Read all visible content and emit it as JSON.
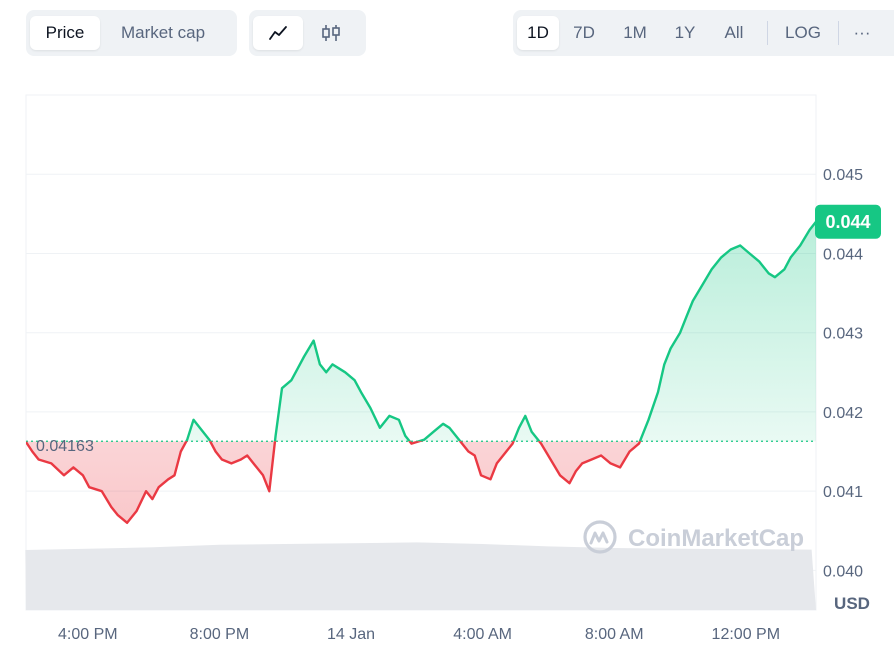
{
  "metric_tabs": [
    {
      "label": "Price",
      "active": true
    },
    {
      "label": "Market cap",
      "active": false
    }
  ],
  "chart_types": [
    {
      "icon": "line-chart-icon",
      "active": true
    },
    {
      "icon": "candlestick-chart-icon",
      "active": false
    }
  ],
  "ranges": [
    {
      "label": "1D",
      "active": true
    },
    {
      "label": "7D",
      "active": false
    },
    {
      "label": "1M",
      "active": false
    },
    {
      "label": "1Y",
      "active": false
    },
    {
      "label": "All",
      "active": false
    }
  ],
  "log_label": "LOG",
  "more_label": "···",
  "watermark": "CoinMarketCap",
  "colors": {
    "up": "#16c784",
    "down": "#ea3943",
    "grid": "#eff2f5",
    "volume": "#e6e8ec",
    "axis_text": "#58667e"
  },
  "chart_data": {
    "type": "line",
    "title": "",
    "xlabel": "",
    "ylabel": "",
    "currency_label": "USD",
    "baseline": 0.04163,
    "baseline_label": "0.04163",
    "current_label": "0.044",
    "ylim": [
      0.0395,
      0.046
    ],
    "xlim": [
      14.1,
      26.6
    ],
    "y_ticks": [
      0.04,
      0.041,
      0.042,
      0.043,
      0.044,
      0.045
    ],
    "y_tick_labels": [
      "0.040",
      "0.041",
      "0.042",
      "0.043",
      "0.044",
      "0.045"
    ],
    "x_ticks": [
      16,
      20,
      24,
      28,
      32,
      36
    ],
    "x_tick_labels": [
      "4:00 PM",
      "8:00 PM",
      "14 Jan",
      "4:00 AM",
      "8:00 AM",
      "12:00 PM"
    ],
    "series": [
      {
        "x": [
          14.1,
          14.2,
          14.3,
          14.5,
          14.7,
          14.85,
          15.0,
          15.1,
          15.3,
          15.45,
          15.55,
          15.7,
          15.85,
          16.0,
          16.1,
          16.2,
          16.35,
          16.45,
          16.55,
          16.65,
          16.75,
          16.85,
          17.0,
          17.1,
          17.2,
          17.35,
          17.5,
          17.6,
          17.75,
          17.85,
          17.95,
          18.05,
          18.15,
          18.3,
          18.4,
          18.5,
          18.65,
          18.75,
          18.85,
          18.95,
          19.05,
          19.15,
          19.3,
          19.4,
          19.55,
          19.7,
          19.85,
          20.0,
          20.1,
          20.2,
          20.4,
          20.55,
          20.7,
          20.8,
          20.9,
          21.0,
          21.1,
          21.2,
          21.3,
          21.45,
          21.55,
          21.7,
          21.8,
          21.9,
          22.0,
          22.1,
          22.25,
          22.4,
          22.55,
          22.7,
          22.8,
          22.9,
          23.05,
          23.2,
          23.35,
          23.5,
          23.65,
          23.8,
          23.95,
          24.1,
          24.2,
          24.3,
          24.45,
          24.55,
          24.65,
          24.8,
          24.95,
          25.1,
          25.25,
          25.4,
          25.55,
          25.7,
          25.85,
          25.95,
          26.1,
          26.2,
          26.35,
          26.5,
          26.6
        ],
        "y": [
          0.04162,
          0.0415,
          0.0414,
          0.04135,
          0.0412,
          0.0413,
          0.0412,
          0.04105,
          0.041,
          0.0408,
          0.0407,
          0.0406,
          0.04075,
          0.041,
          0.0409,
          0.04105,
          0.04115,
          0.0412,
          0.0415,
          0.04165,
          0.0419,
          0.0418,
          0.04165,
          0.0415,
          0.0414,
          0.04135,
          0.0414,
          0.04145,
          0.0413,
          0.0412,
          0.041,
          0.0417,
          0.0423,
          0.0424,
          0.04255,
          0.0427,
          0.0429,
          0.0426,
          0.0425,
          0.0426,
          0.04255,
          0.0425,
          0.0424,
          0.04225,
          0.04205,
          0.0418,
          0.04195,
          0.0419,
          0.0417,
          0.0416,
          0.04165,
          0.04175,
          0.04185,
          0.0418,
          0.0417,
          0.0416,
          0.0415,
          0.04145,
          0.0412,
          0.04115,
          0.04135,
          0.0415,
          0.0416,
          0.0418,
          0.04195,
          0.04175,
          0.0416,
          0.0414,
          0.0412,
          0.0411,
          0.04125,
          0.04135,
          0.0414,
          0.04145,
          0.04135,
          0.0413,
          0.0415,
          0.0416,
          0.0419,
          0.04225,
          0.0426,
          0.0428,
          0.043,
          0.0432,
          0.0434,
          0.0436,
          0.0438,
          0.04395,
          0.04405,
          0.0441,
          0.044,
          0.0439,
          0.04375,
          0.0437,
          0.0438,
          0.04395,
          0.0441,
          0.0443,
          0.0444
        ]
      }
    ],
    "volume": {
      "x": [
        14.1,
        16.0,
        18.0,
        20.0,
        22.0,
        24.0,
        26.0,
        28.0,
        30.0,
        32.0,
        34.0,
        36.0,
        38.0
      ],
      "v": [
        0.55,
        0.58,
        0.62,
        0.68,
        0.7,
        0.72,
        0.74,
        0.7,
        0.64,
        0.6,
        0.58,
        0.57,
        0.56
      ]
    }
  }
}
